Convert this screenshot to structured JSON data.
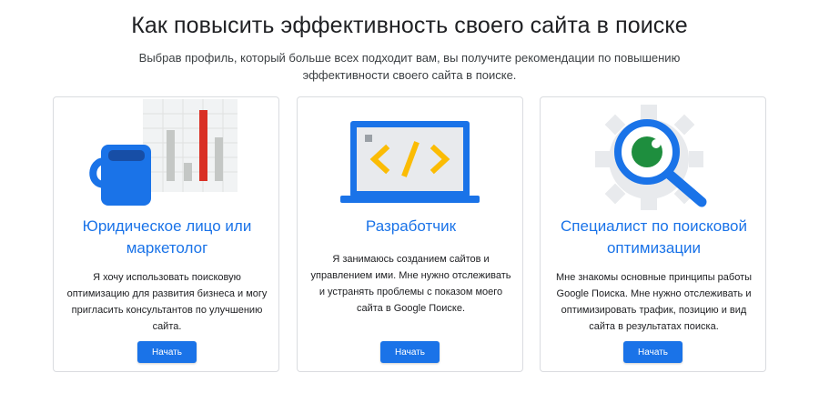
{
  "header": {
    "title": "Как повысить эффективность своего сайта в поиске",
    "subtitle": "Выбрав профиль, который больше всех подходит вам, вы получите рекомендации по повышению эффективности своего сайта в поиске."
  },
  "cards": [
    {
      "title": "Юридическое лицо или маркетолог",
      "description": "Я хочу использовать поисковую оптимизацию для развития бизнеса и могу пригласить консультантов по улучшению сайта.",
      "button_label": "Начать",
      "icon": "mug-chart-icon"
    },
    {
      "title": "Разработчик",
      "description": "Я занимаюсь созданием сайтов и управлением ими. Мне нужно отслеживать и устранять проблемы с показом моего сайта в Google Поиске.",
      "button_label": "Начать",
      "icon": "laptop-code-icon"
    },
    {
      "title": "Специалист по поисковой оптимизации",
      "description": "Мне знакомы основные принципы работы Google Поиска. Мне нужно отслеживать и оптимизировать трафик, позицию и вид сайта в результатах поиска.",
      "button_label": "Начать",
      "icon": "gear-magnifier-icon"
    }
  ],
  "colors": {
    "accent": "#1a73e8",
    "red": "#d93025",
    "yellow": "#fbbc04",
    "green": "#1e8e3e"
  }
}
